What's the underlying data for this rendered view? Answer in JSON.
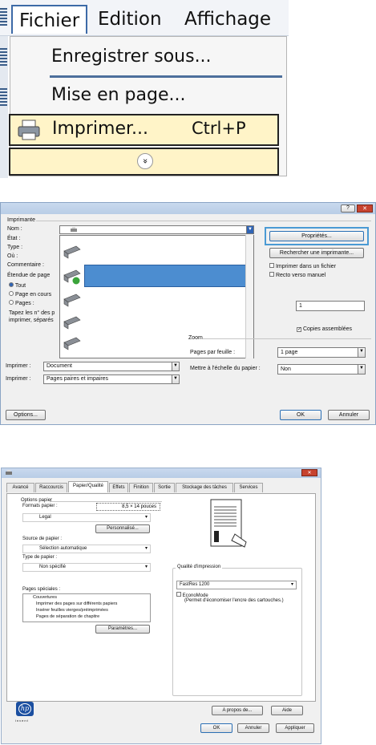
{
  "menu": {
    "tabs": [
      "Fichier",
      "Edition",
      "Affichage"
    ],
    "items": [
      {
        "label": "Enregistrer sous...",
        "shortcut": ""
      },
      {
        "label": "Mise en page...",
        "shortcut": ""
      },
      {
        "label": "Imprimer...",
        "shortcut": "Ctrl+P"
      }
    ],
    "more_glyph": "»"
  },
  "print_dialog": {
    "title_buttons": [
      "?",
      "✕"
    ],
    "printer_group": "Imprimante",
    "name_label": "Nom :",
    "status_label": "État :",
    "type_label": "Type :",
    "where_label": "Où :",
    "comment_label": "Commentaire :",
    "properties_button": "Propriétés...",
    "find_printer_button": "Rechercher une imprimante...",
    "print_to_file": "Imprimer dans un fichier",
    "manual_duplex": "Recto verso manuel",
    "range_group": "Étendue de page",
    "range_all": "Tout",
    "range_current": "Page en cours",
    "range_pages": "Pages :",
    "range_hint_1": "Tapez les n° des p",
    "range_hint_2": "imprimer, séparés",
    "copies_value": "1",
    "collate": "Copies assemblées",
    "zoom_group": "Zoom",
    "print_what_label": "Imprimer :",
    "print_what_value": "Document",
    "print_label": "Imprimer :",
    "print_value": "Pages paires et impaires",
    "pages_per_sheet_label": "Pages par feuille :",
    "pages_per_sheet_value": "1 page",
    "scale_label": "Mettre à l'échelle du papier :",
    "scale_value": "Non",
    "options_button": "Options...",
    "ok_button": "OK",
    "cancel_button": "Annuler"
  },
  "properties_dialog": {
    "close_glyph": "✕",
    "tabs": [
      "Avancé",
      "Raccourcis",
      "Papier/Qualité",
      "Effets",
      "Finition",
      "Sortie",
      "Stockage des tâches",
      "Services"
    ],
    "active_tab": "Papier/Qualité",
    "paper_options_label": "Options papier",
    "paper_sizes_label": "Formats papier :",
    "paper_size_value": "8,5 × 14 pouces",
    "paper_type_value": "Legal",
    "custom_button": "Personnalisé...",
    "paper_source_label": "Source de papier :",
    "paper_source_value": "Sélection automatique",
    "paper_type_label": "Type de papier :",
    "paper_type_select": "Non spécifié",
    "special_pages_label": "Pages spéciales :",
    "special_pages": [
      "Couvertures",
      "Imprimer des pages sur différents papiers",
      "Insérer feuilles vierges/préimprimées",
      "Pages de séparation de chapitre"
    ],
    "settings_button": "Paramètres...",
    "print_quality_label": "Qualité d'impression",
    "print_quality_value": "FastRes 1200",
    "economode_label": "EconoMode",
    "economode_hint": "(Permet d'économiser l'encre des cartouches.)",
    "logo_text": "hp",
    "logo_tagline": "invent",
    "about_button": "A propos de...",
    "help_button": "Aide",
    "ok_button": "OK",
    "cancel_button": "Annuler",
    "apply_button": "Appliquer"
  }
}
